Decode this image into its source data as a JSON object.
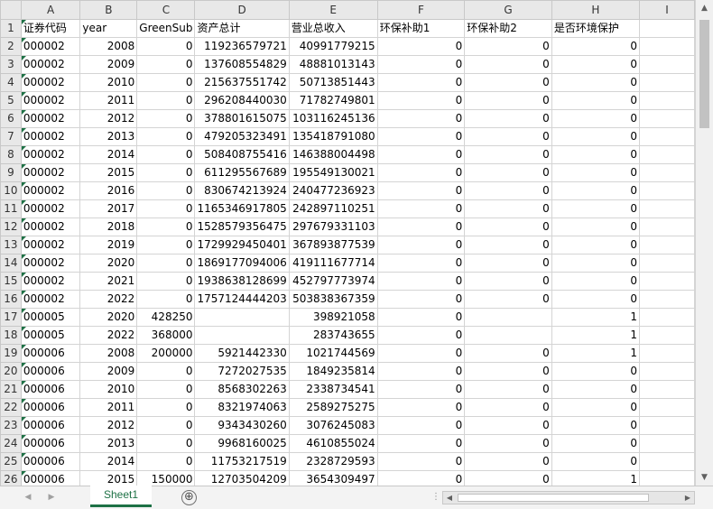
{
  "columns": [
    "A",
    "B",
    "C",
    "D",
    "E",
    "F",
    "G",
    "H",
    "I"
  ],
  "header_row": {
    "num": "1",
    "cells": [
      "证券代码",
      "year",
      "GreenSub",
      "资产总计",
      "营业总收入",
      "环保补助1",
      "环保补助2",
      "是否环境保护",
      ""
    ]
  },
  "rows": [
    {
      "num": "2",
      "cells": [
        "000002",
        "2008",
        "0",
        "119236579721",
        "40991779215",
        "0",
        "0",
        "0",
        ""
      ]
    },
    {
      "num": "3",
      "cells": [
        "000002",
        "2009",
        "0",
        "137608554829",
        "48881013143",
        "0",
        "0",
        "0",
        ""
      ]
    },
    {
      "num": "4",
      "cells": [
        "000002",
        "2010",
        "0",
        "215637551742",
        "50713851443",
        "0",
        "0",
        "0",
        ""
      ]
    },
    {
      "num": "5",
      "cells": [
        "000002",
        "2011",
        "0",
        "296208440030",
        "71782749801",
        "0",
        "0",
        "0",
        ""
      ]
    },
    {
      "num": "6",
      "cells": [
        "000002",
        "2012",
        "0",
        "378801615075",
        "103116245136",
        "0",
        "0",
        "0",
        ""
      ]
    },
    {
      "num": "7",
      "cells": [
        "000002",
        "2013",
        "0",
        "479205323491",
        "135418791080",
        "0",
        "0",
        "0",
        ""
      ]
    },
    {
      "num": "8",
      "cells": [
        "000002",
        "2014",
        "0",
        "508408755416",
        "146388004498",
        "0",
        "0",
        "0",
        ""
      ]
    },
    {
      "num": "9",
      "cells": [
        "000002",
        "2015",
        "0",
        "611295567689",
        "195549130021",
        "0",
        "0",
        "0",
        ""
      ]
    },
    {
      "num": "10",
      "cells": [
        "000002",
        "2016",
        "0",
        "830674213924",
        "240477236923",
        "0",
        "0",
        "0",
        ""
      ]
    },
    {
      "num": "11",
      "cells": [
        "000002",
        "2017",
        "0",
        "1165346917805",
        "242897110251",
        "0",
        "0",
        "0",
        ""
      ]
    },
    {
      "num": "12",
      "cells": [
        "000002",
        "2018",
        "0",
        "1528579356475",
        "297679331103",
        "0",
        "0",
        "0",
        ""
      ]
    },
    {
      "num": "13",
      "cells": [
        "000002",
        "2019",
        "0",
        "1729929450401",
        "367893877539",
        "0",
        "0",
        "0",
        ""
      ]
    },
    {
      "num": "14",
      "cells": [
        "000002",
        "2020",
        "0",
        "1869177094006",
        "419111677714",
        "0",
        "0",
        "0",
        ""
      ]
    },
    {
      "num": "15",
      "cells": [
        "000002",
        "2021",
        "0",
        "1938638128699",
        "452797773974",
        "0",
        "0",
        "0",
        ""
      ]
    },
    {
      "num": "16",
      "cells": [
        "000002",
        "2022",
        "0",
        "1757124444203",
        "503838367359",
        "0",
        "0",
        "0",
        ""
      ]
    },
    {
      "num": "17",
      "cells": [
        "000005",
        "2020",
        "428250",
        "",
        "398921058",
        "0",
        "",
        "1",
        ""
      ]
    },
    {
      "num": "18",
      "cells": [
        "000005",
        "2022",
        "368000",
        "",
        "283743655",
        "0",
        "",
        "1",
        ""
      ]
    },
    {
      "num": "19",
      "cells": [
        "000006",
        "2008",
        "200000",
        "5921442330",
        "1021744569",
        "0",
        "0",
        "1",
        ""
      ]
    },
    {
      "num": "20",
      "cells": [
        "000006",
        "2009",
        "0",
        "7272027535",
        "1849235814",
        "0",
        "0",
        "0",
        ""
      ]
    },
    {
      "num": "21",
      "cells": [
        "000006",
        "2010",
        "0",
        "8568302263",
        "2338734541",
        "0",
        "0",
        "0",
        ""
      ]
    },
    {
      "num": "22",
      "cells": [
        "000006",
        "2011",
        "0",
        "8321974063",
        "2589275275",
        "0",
        "0",
        "0",
        ""
      ]
    },
    {
      "num": "23",
      "cells": [
        "000006",
        "2012",
        "0",
        "9343430260",
        "3076245083",
        "0",
        "0",
        "0",
        ""
      ]
    },
    {
      "num": "24",
      "cells": [
        "000006",
        "2013",
        "0",
        "9968160025",
        "4610855024",
        "0",
        "0",
        "0",
        ""
      ]
    },
    {
      "num": "25",
      "cells": [
        "000006",
        "2014",
        "0",
        "11753217519",
        "2328729593",
        "0",
        "0",
        "0",
        ""
      ]
    },
    {
      "num": "26",
      "cells": [
        "000006",
        "2015",
        "150000",
        "12703504209",
        "3654309497",
        "0",
        "0",
        "1",
        ""
      ]
    }
  ],
  "sheet_tab": "Sheet1",
  "add_sheet_symbol": "⊕",
  "colors": {
    "accent": "#1e7145",
    "header_bg": "#e8e8e8",
    "gridline": "#d4d4d4"
  }
}
